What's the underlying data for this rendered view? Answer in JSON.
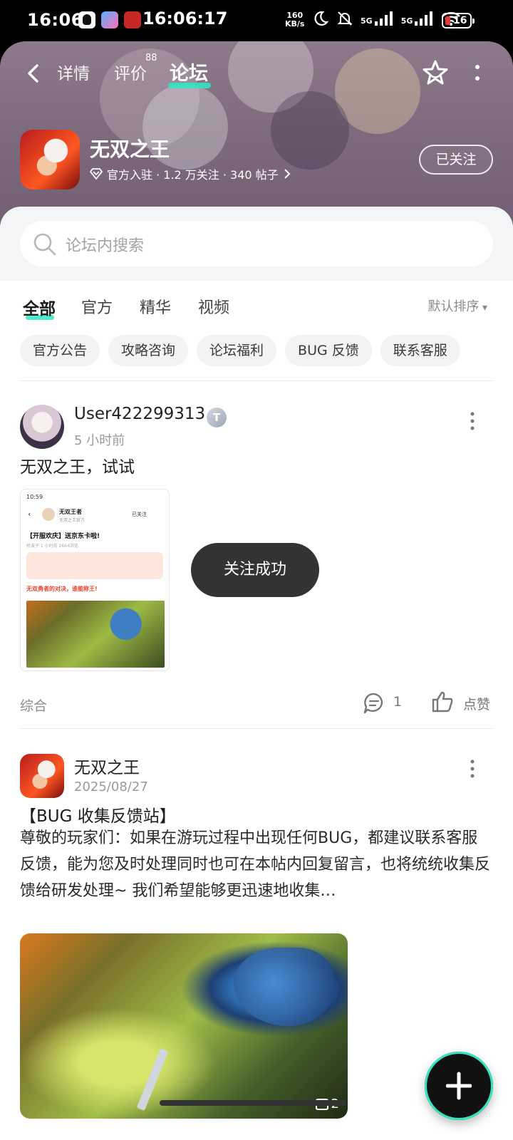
{
  "status_bar": {
    "time": "16:06",
    "time_secondary": "16:06:17",
    "net_speed_value": "160",
    "net_speed_unit": "KB/s",
    "network_5g_a": "5G",
    "network_5g_b": "5G",
    "battery": "16"
  },
  "header": {
    "tabs": [
      {
        "label": "详情"
      },
      {
        "label": "评价",
        "badge": "88"
      },
      {
        "label": "论坛",
        "active": true
      }
    ],
    "game_name": "无双之王",
    "game_meta": "官方入驻 · 1.2 万关注 · 340 帖子",
    "follow_label": "已关注"
  },
  "search": {
    "placeholder": "论坛内搜索"
  },
  "filters": {
    "tabs": [
      "全部",
      "官方",
      "精华",
      "视频"
    ],
    "sort_label": "默认排序",
    "chips": [
      "官方公告",
      "攻略咨询",
      "论坛福利",
      "BUG 反馈",
      "联系客服"
    ]
  },
  "posts": [
    {
      "author": "User422299313",
      "badge": "T",
      "time": "5 小时前",
      "title": "无双之王，试试",
      "screenshot": {
        "status_time": "10:59",
        "header_title": "无双王者",
        "header_sub": "无双之王官方",
        "follow": "已关注",
        "post_title": "【开服欢庆】送京东卡啦!",
        "post_meta": "桥波子 1 小时前   2664浏览",
        "red_text": "无双勇者的对决，谁能称王!"
      },
      "tag": "综合",
      "comments": "1",
      "like_label": "点赞"
    },
    {
      "author": "无双之王",
      "time": "2025/08/27",
      "title": "【BUG 收集反馈站】",
      "body": "尊敬的玩家们：如果在游玩过程中出现任何BUG，都建议联系客服反馈，能为您及时处理同时也可在本帖内回复留言，也将统统收集反馈给研发处理~ 我们希望能够更迅速地收集…",
      "image_count": "2"
    }
  ],
  "toast": "关注成功",
  "colors": {
    "accent": "#2ee8c4",
    "toast_bg": "#333333",
    "header_bg": "#7d6a7e"
  }
}
